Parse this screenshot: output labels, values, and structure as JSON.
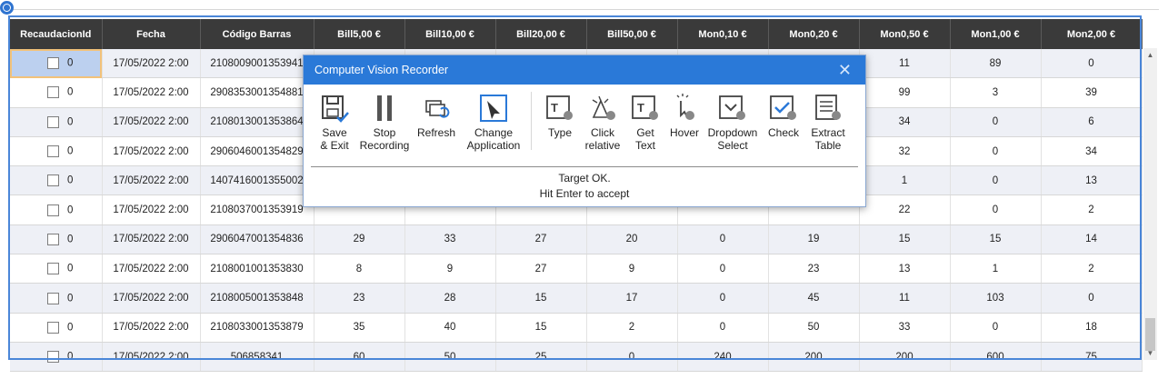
{
  "grid": {
    "columns": [
      "RecaudacionId",
      "Fecha",
      "Código Barras",
      "Bill5,00 €",
      "Bill10,00 €",
      "Bill20,00 €",
      "Bill50,00 €",
      "Mon0,10 €",
      "Mon0,20 €",
      "Mon0,50 €",
      "Mon1,00 €",
      "Mon2,00 €"
    ],
    "rows": [
      [
        "0",
        "17/05/2022 2:00",
        "2108009001353941",
        "",
        "",
        "",
        "",
        "",
        "",
        "11",
        "89",
        "0"
      ],
      [
        "0",
        "17/05/2022 2:00",
        "2908353001354881",
        "",
        "",
        "",
        "",
        "",
        "",
        "99",
        "3",
        "39"
      ],
      [
        "0",
        "17/05/2022 2:00",
        "2108013001353864",
        "",
        "",
        "",
        "",
        "",
        "",
        "34",
        "0",
        "6"
      ],
      [
        "0",
        "17/05/2022 2:00",
        "2906046001354829",
        "",
        "",
        "",
        "",
        "",
        "",
        "32",
        "0",
        "34"
      ],
      [
        "0",
        "17/05/2022 2:00",
        "1407416001355002",
        "",
        "",
        "",
        "",
        "",
        "",
        "1",
        "0",
        "13"
      ],
      [
        "0",
        "17/05/2022 2:00",
        "2108037001353919",
        "",
        "",
        "",
        "",
        "",
        "",
        "22",
        "0",
        "2"
      ],
      [
        "0",
        "17/05/2022 2:00",
        "2906047001354836",
        "29",
        "33",
        "27",
        "20",
        "0",
        "19",
        "15",
        "15",
        "14"
      ],
      [
        "0",
        "17/05/2022 2:00",
        "2108001001353830",
        "8",
        "9",
        "27",
        "9",
        "0",
        "23",
        "13",
        "1",
        "2"
      ],
      [
        "0",
        "17/05/2022 2:00",
        "2108005001353848",
        "23",
        "28",
        "15",
        "17",
        "0",
        "45",
        "11",
        "103",
        "0"
      ],
      [
        "0",
        "17/05/2022 2:00",
        "2108033001353879",
        "35",
        "40",
        "15",
        "2",
        "0",
        "50",
        "33",
        "0",
        "18"
      ],
      [
        "0",
        "17/05/2022 2:00",
        "506858341",
        "60",
        "50",
        "25",
        "0",
        "240",
        "200",
        "200",
        "600",
        "75"
      ]
    ]
  },
  "recorder": {
    "title": "Computer Vision Recorder",
    "close": "✕",
    "tools": [
      {
        "label1": "Save",
        "label2": "& Exit"
      },
      {
        "label1": "Stop",
        "label2": "Recording"
      },
      {
        "label1": "Refresh",
        "label2": ""
      },
      {
        "label1": "Change",
        "label2": "Application"
      },
      {
        "label1": "Type",
        "label2": ""
      },
      {
        "label1": "Click",
        "label2": "relative"
      },
      {
        "label1": "Get",
        "label2": "Text"
      },
      {
        "label1": "Hover",
        "label2": ""
      },
      {
        "label1": "Dropdown",
        "label2": "Select"
      },
      {
        "label1": "Check",
        "label2": ""
      },
      {
        "label1": "Extract",
        "label2": "Table"
      }
    ],
    "status_line1": "Target OK.",
    "status_line2": "Hit Enter to accept"
  },
  "colors": {
    "header_bg": "#3a3a3a",
    "title_bar": "#2a79d8",
    "selection_frame": "#4a86d8"
  },
  "icons": [
    "save-icon",
    "stop-icon",
    "refresh-icon",
    "cursor-icon",
    "type-icon",
    "click-relative-icon",
    "get-text-icon",
    "hover-icon",
    "dropdown-icon",
    "check-icon",
    "extract-table-icon",
    "close-icon",
    "target-icon"
  ]
}
